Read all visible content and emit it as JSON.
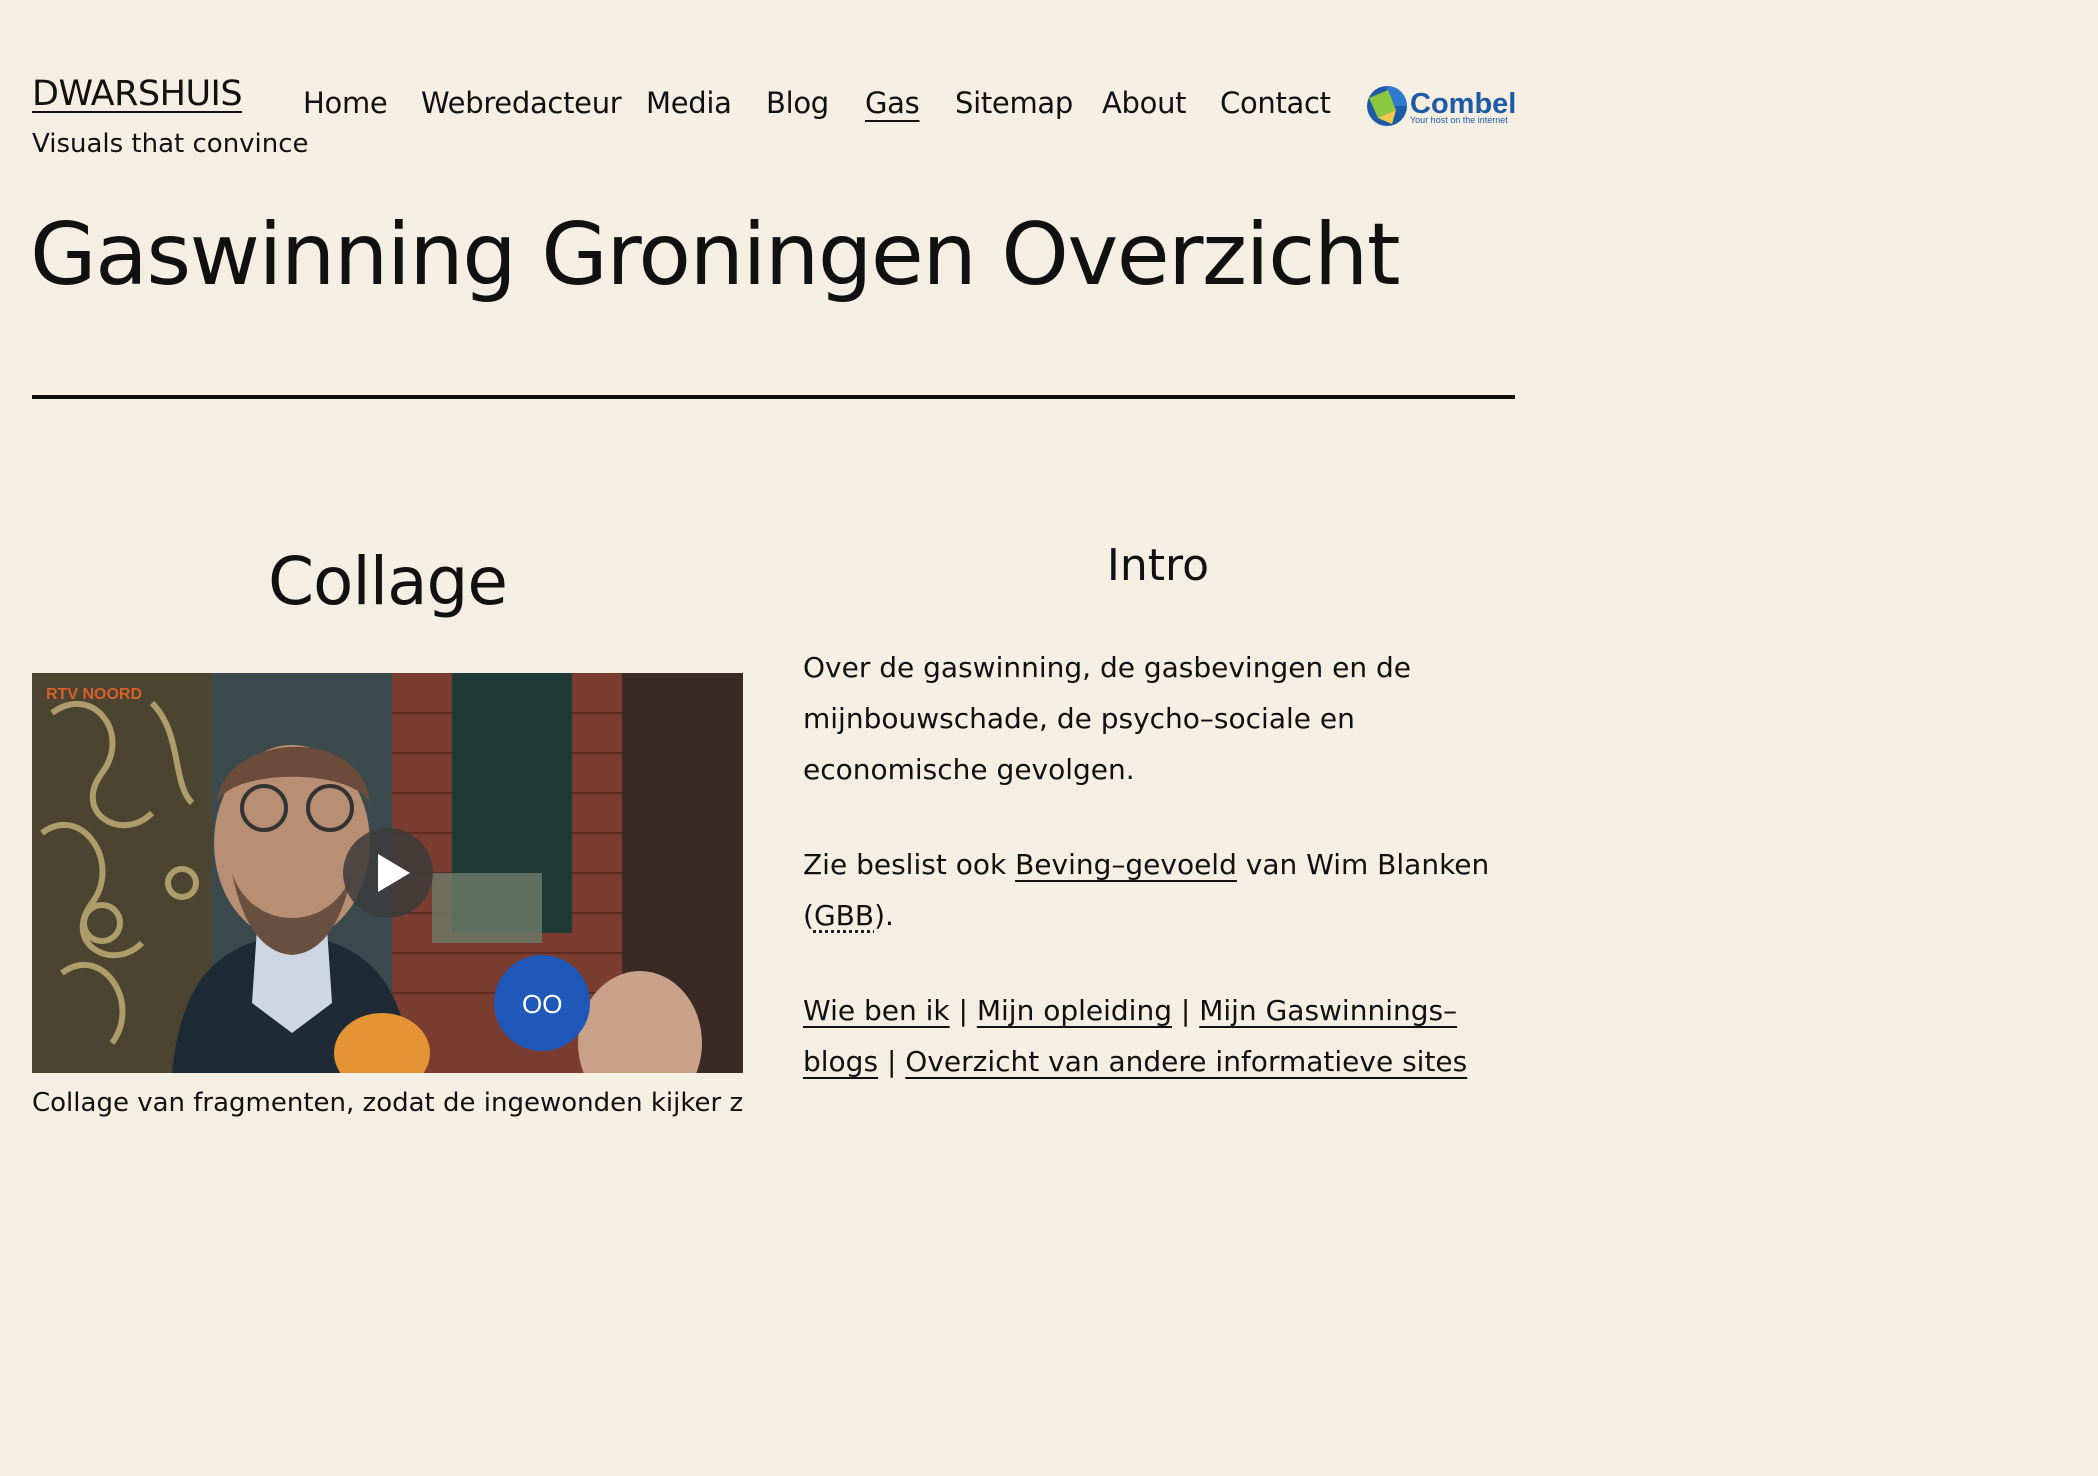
{
  "site": {
    "title": "DWARSHUIS",
    "tagline": "Visuals that convince"
  },
  "nav": {
    "items": [
      {
        "label": "Home"
      },
      {
        "label": "Webredacteur"
      },
      {
        "label": "Media"
      },
      {
        "label": "Blog"
      },
      {
        "label": "Gas",
        "active": true
      },
      {
        "label": "Sitemap"
      },
      {
        "label": "About"
      },
      {
        "label": "Contact"
      }
    ]
  },
  "logo": {
    "name": "Combell",
    "tagline": "Your host on the internet",
    "colors": {
      "blue": "#1f5aa6",
      "green": "#8cc63f",
      "yellow": "#f2c94c"
    }
  },
  "page": {
    "title": "Gaswinning Groningen Overzicht"
  },
  "left": {
    "heading": "Collage",
    "video": {
      "channel_label": "RTV NOORD",
      "caption": "Collage van fragmenten, zodat de ingewonden kijker ziet hoe ik"
    }
  },
  "right": {
    "heading": "Intro",
    "p1": "Over de gaswinning, de gasbevingen en de mijnbouwschade, de psycho–sociale en economische gevolgen.",
    "p2": {
      "before": "Zie beslist ook ",
      "link": "Beving–gevoeld",
      "middle": " van Wim Blanken (",
      "abbr": "GBB",
      "after": ")."
    },
    "p3": {
      "link1": "Wie ben ik",
      "sep": " | ",
      "link2": "Mijn opleiding",
      "link3": "Mijn Gaswinnings–blogs",
      "link4": "Overzicht van andere informatieve sites"
    }
  },
  "colors": {
    "background": "#f4efe2",
    "text": "#111111"
  }
}
